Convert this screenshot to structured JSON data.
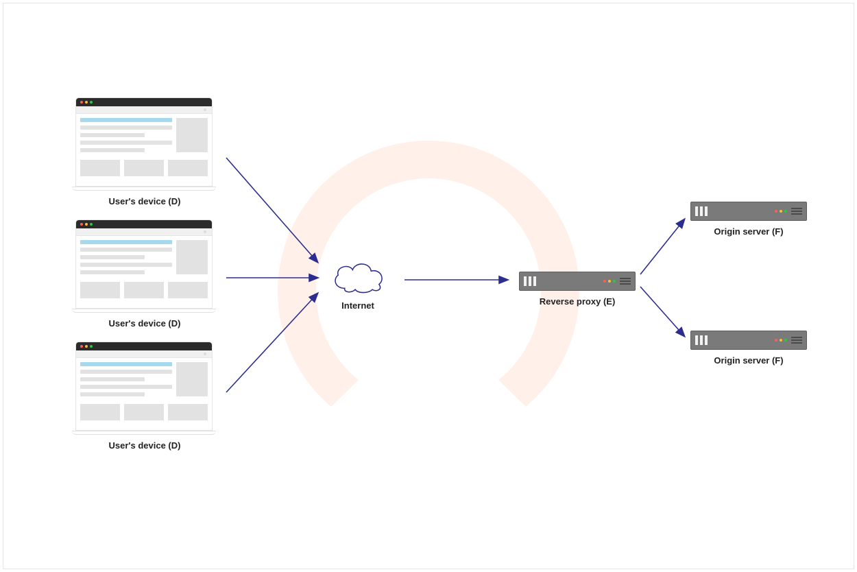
{
  "labels": {
    "device1": "User's device (D)",
    "device2": "User's device (D)",
    "device3": "User's device (D)",
    "internet": "Internet",
    "reverse_proxy": "Reverse proxy (E)",
    "origin1": "Origin server (F)",
    "origin2": "Origin server (F)"
  },
  "colors": {
    "arrow": "#2d2d8f",
    "ring": "#fff0e9",
    "server": "#7a7a7a",
    "accent_line": "#a6d9ed"
  }
}
